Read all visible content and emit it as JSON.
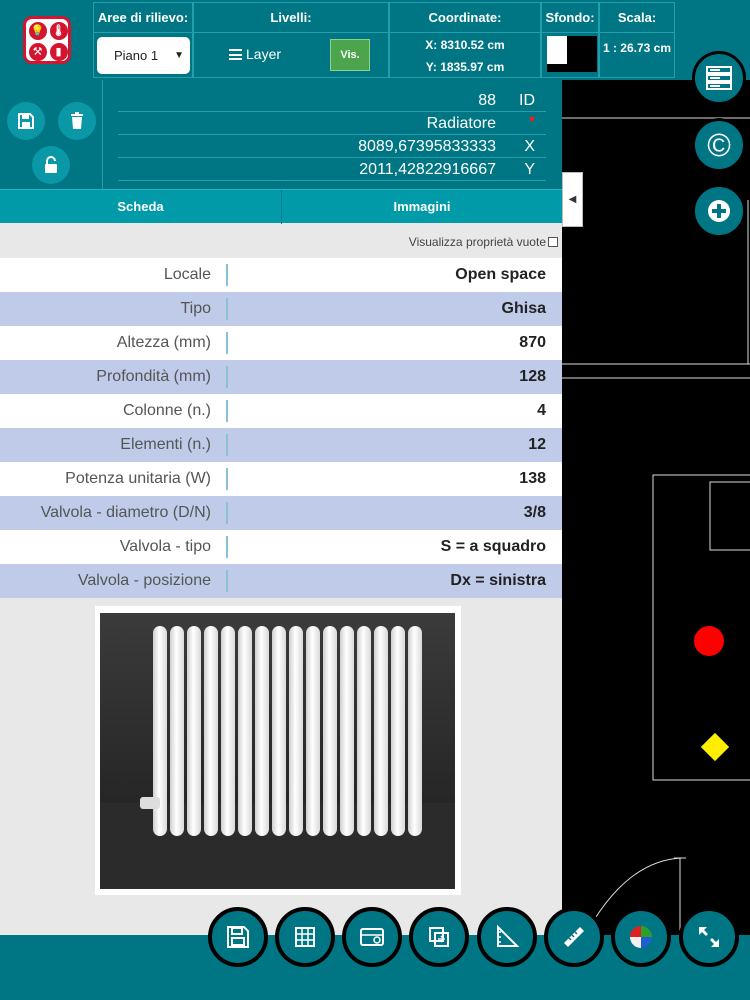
{
  "toolbar": {
    "areas_header": "Aree di rilievo:",
    "area_selected": "Piano 1",
    "levels_header": "Livelli:",
    "layer_label": "Layer",
    "vis_label": "Vis.",
    "coords_header": "Coordinate:",
    "coord_x": "X: 8310.52 cm",
    "coord_y": "Y: 1835.97 cm",
    "background_header": "Sfondo:",
    "scale_header": "Scala:",
    "scale_value": "1 : 26.73 cm"
  },
  "detail": {
    "id_value": "88",
    "id_key": "ID",
    "name_value": "Radiatore",
    "x_value": "8089,67395833333",
    "x_key": "X",
    "y_value": "2011,42822916667",
    "y_key": "Y"
  },
  "tabs": {
    "scheda": "Scheda",
    "immagini": "Immagini"
  },
  "show_empty_label": "Visualizza proprietà vuote",
  "properties": [
    {
      "label": "Locale",
      "value": "Open space"
    },
    {
      "label": "Tipo",
      "value": "Ghisa"
    },
    {
      "label": "Altezza (mm)",
      "value": "870"
    },
    {
      "label": "Profondità (mm)",
      "value": "128"
    },
    {
      "label": "Colonne (n.)",
      "value": "4"
    },
    {
      "label": "Elementi (n.)",
      "value": "12"
    },
    {
      "label": "Potenza unitaria (W)",
      "value": "138"
    },
    {
      "label": "Valvola - diametro (D/N)",
      "value": "3/8"
    },
    {
      "label": "Valvola - tipo",
      "value": "S = a squadro"
    },
    {
      "label": "Valvola - posizione",
      "value": "Dx = sinistra"
    }
  ],
  "icons": {
    "save": "save-icon",
    "delete": "trash-icon",
    "unlock": "unlock-icon",
    "layers_menu": "server-stack-icon",
    "copyright": "copyright-icon",
    "add": "plus-circle-icon",
    "bottom": [
      "save-icon",
      "grid-icon",
      "measure-icon",
      "copy-icon",
      "triangle-ruler-icon",
      "ruler-icon",
      "color-wheel-icon",
      "expand-icon"
    ]
  },
  "colors": {
    "primary": "#007684",
    "tab": "#009aa8",
    "vis_button": "#4ca54c",
    "row_alt": "#bfcbe8",
    "marker_circle": "#ff0000",
    "marker_diamond": "#ffee00"
  }
}
